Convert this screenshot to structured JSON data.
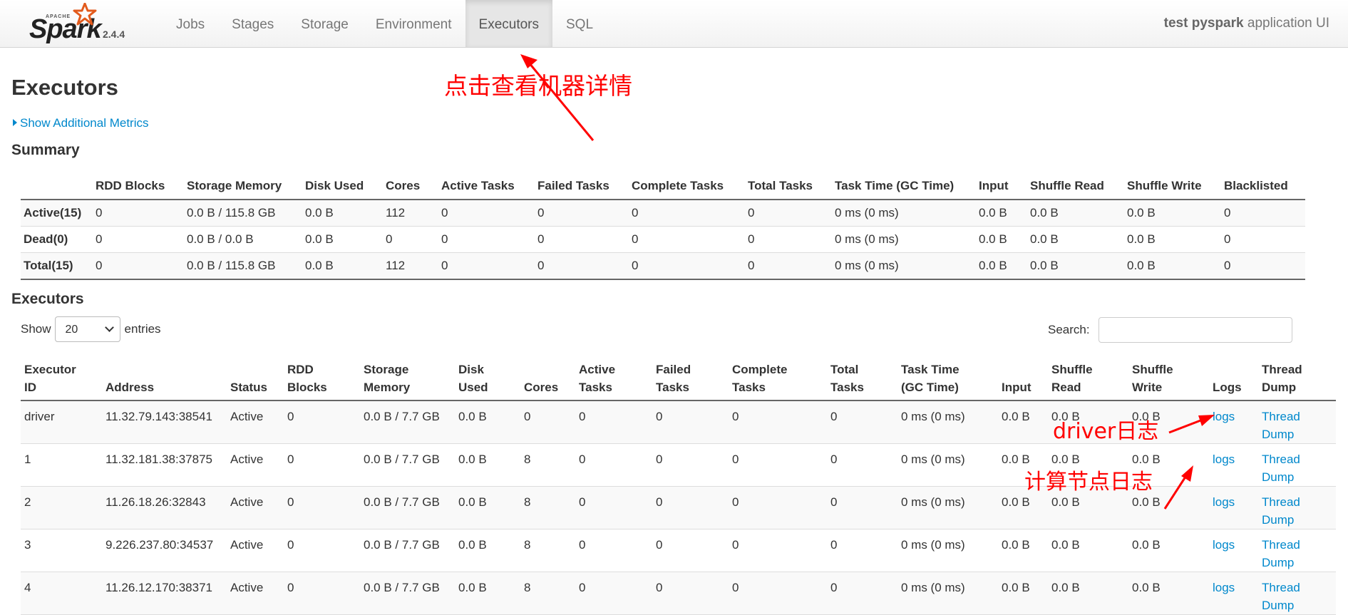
{
  "navbar": {
    "logo_text": "Spark",
    "logo_small": "APACHE",
    "version": "2.4.4",
    "items": [
      {
        "label": "Jobs",
        "active": false
      },
      {
        "label": "Stages",
        "active": false
      },
      {
        "label": "Storage",
        "active": false
      },
      {
        "label": "Environment",
        "active": false
      },
      {
        "label": "Executors",
        "active": true
      },
      {
        "label": "SQL",
        "active": false
      }
    ],
    "app_name": "test pyspark",
    "app_suffix": " application UI"
  },
  "page": {
    "title": "Executors",
    "show_metrics": "Show Additional Metrics",
    "summary_title": "Summary",
    "executors_title": "Executors"
  },
  "summary": {
    "headers": [
      "",
      "RDD Blocks",
      "Storage Memory",
      "Disk Used",
      "Cores",
      "Active Tasks",
      "Failed Tasks",
      "Complete Tasks",
      "Total Tasks",
      "Task Time (GC Time)",
      "Input",
      "Shuffle Read",
      "Shuffle Write",
      "Blacklisted"
    ],
    "rows": [
      [
        "Active(15)",
        "0",
        "0.0 B / 115.8 GB",
        "0.0 B",
        "112",
        "0",
        "0",
        "0",
        "0",
        "0 ms (0 ms)",
        "0.0 B",
        "0.0 B",
        "0.0 B",
        "0"
      ],
      [
        "Dead(0)",
        "0",
        "0.0 B / 0.0 B",
        "0.0 B",
        "0",
        "0",
        "0",
        "0",
        "0",
        "0 ms (0 ms)",
        "0.0 B",
        "0.0 B",
        "0.0 B",
        "0"
      ],
      [
        "Total(15)",
        "0",
        "0.0 B / 115.8 GB",
        "0.0 B",
        "112",
        "0",
        "0",
        "0",
        "0",
        "0 ms (0 ms)",
        "0.0 B",
        "0.0 B",
        "0.0 B",
        "0"
      ]
    ]
  },
  "controls": {
    "show_label": "Show",
    "entries_value": "20",
    "entries_label": "entries",
    "search_label": "Search:"
  },
  "executors": {
    "headers": [
      [
        "Executor",
        "ID"
      ],
      [
        "",
        "Address"
      ],
      [
        "",
        "Status"
      ],
      [
        "RDD",
        "Blocks"
      ],
      [
        "Storage",
        "Memory"
      ],
      [
        "Disk",
        "Used"
      ],
      [
        "",
        "Cores"
      ],
      [
        "Active",
        "Tasks"
      ],
      [
        "Failed",
        "Tasks"
      ],
      [
        "Complete",
        "Tasks"
      ],
      [
        "Total",
        "Tasks"
      ],
      [
        "Task Time",
        "(GC Time)"
      ],
      [
        "",
        "Input"
      ],
      [
        "Shuffle",
        "Read"
      ],
      [
        "Shuffle",
        "Write"
      ],
      [
        "",
        "Logs"
      ],
      [
        "Thread",
        "Dump"
      ]
    ],
    "rows": [
      [
        "driver",
        "11.32.79.143:38541",
        "Active",
        "0",
        "0.0 B / 7.7 GB",
        "0.0 B",
        "0",
        "0",
        "0",
        "0",
        "0",
        "0 ms (0 ms)",
        "0.0 B",
        "0.0 B",
        "0.0 B",
        "logs",
        "Thread Dump"
      ],
      [
        "1",
        "11.32.181.38:37875",
        "Active",
        "0",
        "0.0 B / 7.7 GB",
        "0.0 B",
        "8",
        "0",
        "0",
        "0",
        "0",
        "0 ms (0 ms)",
        "0.0 B",
        "0.0 B",
        "0.0 B",
        "logs",
        "Thread Dump"
      ],
      [
        "2",
        "11.26.18.26:32843",
        "Active",
        "0",
        "0.0 B / 7.7 GB",
        "0.0 B",
        "8",
        "0",
        "0",
        "0",
        "0",
        "0 ms (0 ms)",
        "0.0 B",
        "0.0 B",
        "0.0 B",
        "logs",
        "Thread Dump"
      ],
      [
        "3",
        "9.226.237.80:34537",
        "Active",
        "0",
        "0.0 B / 7.7 GB",
        "0.0 B",
        "8",
        "0",
        "0",
        "0",
        "0",
        "0 ms (0 ms)",
        "0.0 B",
        "0.0 B",
        "0.0 B",
        "logs",
        "Thread Dump"
      ],
      [
        "4",
        "11.26.12.170:38371",
        "Active",
        "0",
        "0.0 B / 7.7 GB",
        "0.0 B",
        "8",
        "0",
        "0",
        "0",
        "0",
        "0 ms (0 ms)",
        "0.0 B",
        "0.0 B",
        "0.0 B",
        "logs",
        "Thread Dump"
      ]
    ]
  },
  "annotations": {
    "executors_tab": "点击查看机器详情",
    "driver_logs": "driver日志",
    "node_logs": "计算节点日志",
    "color": "#ff0000"
  }
}
